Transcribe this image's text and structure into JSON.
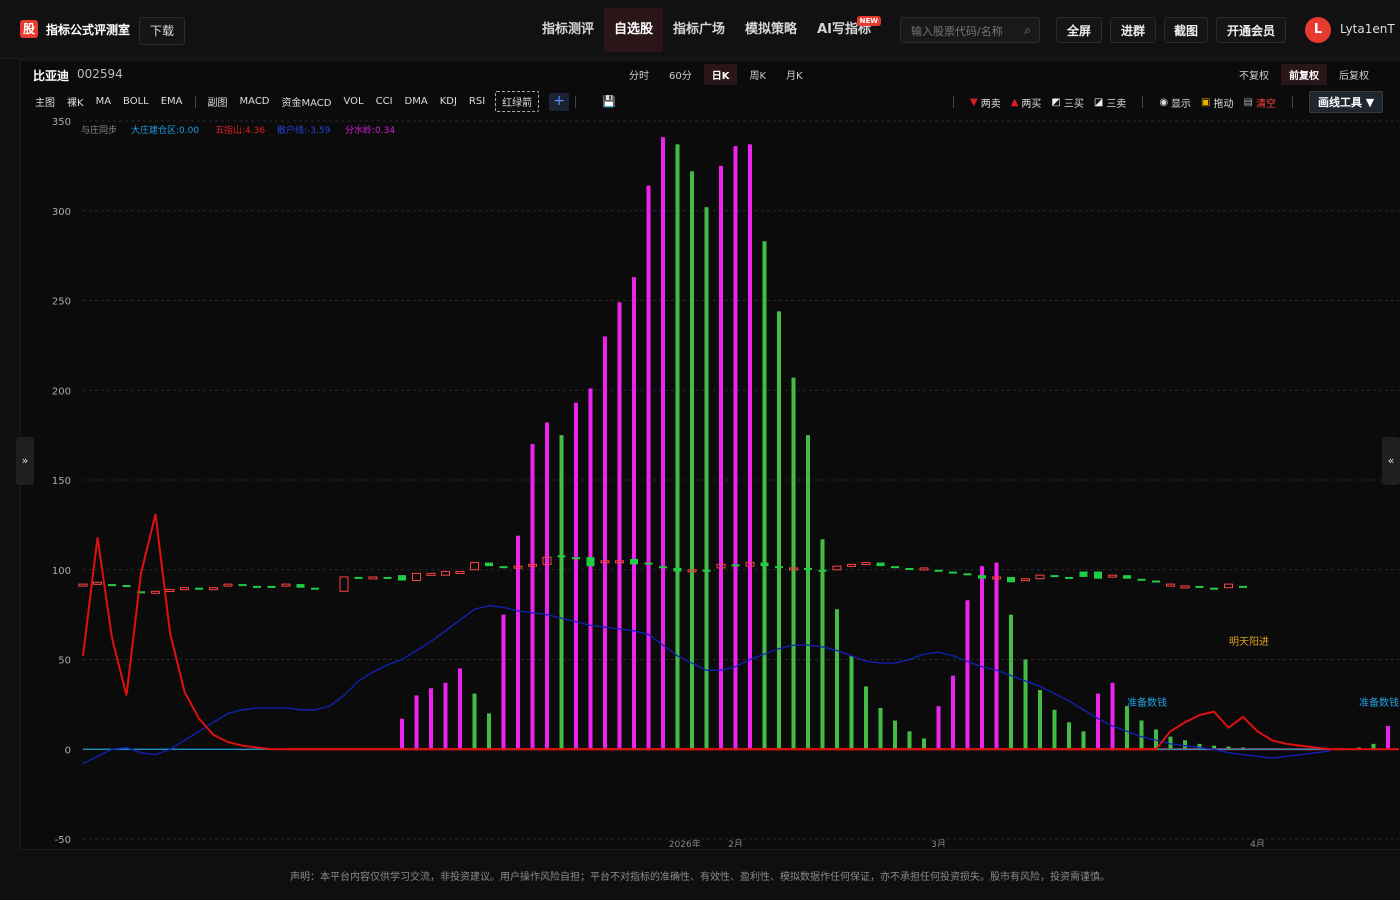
{
  "app": {
    "logo_glyph": "股",
    "title": "指标公式评测室",
    "download_label": "下载"
  },
  "nav": [
    {
      "label": "指标测评",
      "active": false
    },
    {
      "label": "自选股",
      "active": true
    },
    {
      "label": "指标广场",
      "active": false
    },
    {
      "label": "模拟策略",
      "active": false
    },
    {
      "label": "AI写指标",
      "active": false,
      "badge": "NEW"
    }
  ],
  "search": {
    "placeholder": "输入股票代码/名称",
    "icon": "search-icon"
  },
  "top_buttons": {
    "fullscreen": "全屏",
    "join_group": "进群",
    "screenshot": "截图",
    "vip": "开通会员"
  },
  "user": {
    "initial": "L",
    "name": "Lyta1enT",
    "avatar_color": "#e63b2e"
  },
  "stock": {
    "name": "比亚迪",
    "code": "002594"
  },
  "period_tabs": [
    {
      "label": "分时"
    },
    {
      "label": "60分"
    },
    {
      "label": "日K",
      "active": true
    },
    {
      "label": "周K"
    },
    {
      "label": "月K"
    }
  ],
  "adjust_tabs": [
    {
      "label": "不复权"
    },
    {
      "label": "前复权",
      "active": true
    },
    {
      "label": "后复权"
    }
  ],
  "indicators": {
    "main_label": "主图",
    "main": [
      "裸K",
      "MA",
      "BOLL",
      "EMA"
    ],
    "sub_label": "副图",
    "sub": [
      "MACD",
      "资金MACD",
      "VOL",
      "CCI",
      "DMA",
      "KDJ",
      "RSI"
    ],
    "custom": "红绿箭"
  },
  "tools": {
    "two_sell": "两卖",
    "two_buy": "两买",
    "three_buy": "三买",
    "three_sell": "三卖",
    "show": "显示",
    "drag": "拖动",
    "clear": "清空",
    "draw_tools": "画线工具 ▼"
  },
  "legend": [
    {
      "label": "与庄同步",
      "color": "#888888"
    },
    {
      "label": "大庄建仓区:0.00",
      "color": "#1e9ee8"
    },
    {
      "label": "五指山:4.36",
      "color": "#e02020"
    },
    {
      "label": "散户线:-3.59",
      "color": "#2244dd"
    },
    {
      "label": "分水岭:0.34",
      "color": "#d020d0"
    }
  ],
  "annotations": {
    "tomorrow": "明天阳进",
    "prepare1": "准备数钱",
    "prepare2": "准备数钱"
  },
  "x_labels": [
    "2026年",
    "2月",
    "3月",
    "4月"
  ],
  "colors": {
    "up_bar": "#ee22ee",
    "down_bar": "#44bb44",
    "candle_up": "#ff4444",
    "candle_down": "#22cc44",
    "red_line": "#e01010",
    "blue_line": "#1122bb",
    "zero_line": "#1aa0d0"
  },
  "disclaimer": "声明：本平台内容仅供学习交流，非投资建议。用户操作风险自担；平台不对指标的准确性、有效性、盈利性、模拟数据作任何保证，亦不承担任何投资损失。股市有风险，投资需谨慎。",
  "chart_data": {
    "type": "bar",
    "ylim": [
      -50,
      350
    ],
    "yticks": [
      350,
      300,
      250,
      200,
      150,
      100,
      50,
      0,
      -50
    ],
    "grid": true,
    "bars": [
      {
        "x": 22,
        "v": 17,
        "c": "up"
      },
      {
        "x": 23,
        "v": 30,
        "c": "up"
      },
      {
        "x": 24,
        "v": 34,
        "c": "up"
      },
      {
        "x": 25,
        "v": 37,
        "c": "up"
      },
      {
        "x": 26,
        "v": 45,
        "c": "up"
      },
      {
        "x": 27,
        "v": 31,
        "c": "down"
      },
      {
        "x": 28,
        "v": 20,
        "c": "down"
      },
      {
        "x": 29,
        "v": 75,
        "c": "up"
      },
      {
        "x": 30,
        "v": 119,
        "c": "up"
      },
      {
        "x": 31,
        "v": 170,
        "c": "up"
      },
      {
        "x": 32,
        "v": 182,
        "c": "up"
      },
      {
        "x": 33,
        "v": 175,
        "c": "down"
      },
      {
        "x": 34,
        "v": 193,
        "c": "up"
      },
      {
        "x": 35,
        "v": 201,
        "c": "up"
      },
      {
        "x": 36,
        "v": 230,
        "c": "up"
      },
      {
        "x": 37,
        "v": 249,
        "c": "up"
      },
      {
        "x": 38,
        "v": 263,
        "c": "up"
      },
      {
        "x": 39,
        "v": 314,
        "c": "up"
      },
      {
        "x": 40,
        "v": 341,
        "c": "up"
      },
      {
        "x": 41,
        "v": 337,
        "c": "down"
      },
      {
        "x": 42,
        "v": 322,
        "c": "down"
      },
      {
        "x": 43,
        "v": 302,
        "c": "down"
      },
      {
        "x": 44,
        "v": 325,
        "c": "up"
      },
      {
        "x": 45,
        "v": 336,
        "c": "up"
      },
      {
        "x": 46,
        "v": 337,
        "c": "up"
      },
      {
        "x": 47,
        "v": 283,
        "c": "down"
      },
      {
        "x": 48,
        "v": 244,
        "c": "down"
      },
      {
        "x": 49,
        "v": 207,
        "c": "down"
      },
      {
        "x": 50,
        "v": 175,
        "c": "down"
      },
      {
        "x": 51,
        "v": 117,
        "c": "down"
      },
      {
        "x": 52,
        "v": 78,
        "c": "down"
      },
      {
        "x": 53,
        "v": 52,
        "c": "down"
      },
      {
        "x": 54,
        "v": 35,
        "c": "down"
      },
      {
        "x": 55,
        "v": 23,
        "c": "down"
      },
      {
        "x": 56,
        "v": 16,
        "c": "down"
      },
      {
        "x": 57,
        "v": 10,
        "c": "down"
      },
      {
        "x": 58,
        "v": 6,
        "c": "down"
      },
      {
        "x": 59,
        "v": 24,
        "c": "up"
      },
      {
        "x": 60,
        "v": 41,
        "c": "up"
      },
      {
        "x": 61,
        "v": 83,
        "c": "up"
      },
      {
        "x": 62,
        "v": 102,
        "c": "up"
      },
      {
        "x": 63,
        "v": 104,
        "c": "up"
      },
      {
        "x": 64,
        "v": 75,
        "c": "down"
      },
      {
        "x": 65,
        "v": 50,
        "c": "down"
      },
      {
        "x": 66,
        "v": 33,
        "c": "down"
      },
      {
        "x": 67,
        "v": 22,
        "c": "down"
      },
      {
        "x": 68,
        "v": 15,
        "c": "down"
      },
      {
        "x": 69,
        "v": 10,
        "c": "down"
      },
      {
        "x": 70,
        "v": 31,
        "c": "up"
      },
      {
        "x": 71,
        "v": 37,
        "c": "up"
      },
      {
        "x": 72,
        "v": 24,
        "c": "down"
      },
      {
        "x": 73,
        "v": 16,
        "c": "down"
      },
      {
        "x": 74,
        "v": 11,
        "c": "down"
      },
      {
        "x": 75,
        "v": 7,
        "c": "down"
      },
      {
        "x": 76,
        "v": 5,
        "c": "down"
      },
      {
        "x": 77,
        "v": 3,
        "c": "down"
      },
      {
        "x": 78,
        "v": 2,
        "c": "down"
      },
      {
        "x": 79,
        "v": 1.5,
        "c": "down"
      },
      {
        "x": 80,
        "v": 1,
        "c": "down"
      },
      {
        "x": 88,
        "v": 1,
        "c": "down"
      },
      {
        "x": 89,
        "v": 3,
        "c": "down"
      },
      {
        "x": 90,
        "v": 13,
        "c": "up"
      },
      {
        "x": 91,
        "v": 9,
        "c": "down"
      },
      {
        "x": 92,
        "v": 6,
        "c": "down"
      },
      {
        "x": 93,
        "v": 4,
        "c": "down"
      },
      {
        "x": 94,
        "v": 2,
        "c": "down"
      },
      {
        "x": 95,
        "v": 1.5,
        "c": "down"
      },
      {
        "x": 96,
        "v": 1,
        "c": "down"
      },
      {
        "x": 97,
        "v": 1,
        "c": "down"
      }
    ],
    "candles": [
      {
        "x": 0,
        "o": 92,
        "c": 92,
        "u": 1
      },
      {
        "x": 1,
        "o": 92,
        "c": 93,
        "u": 1
      },
      {
        "x": 2,
        "o": 92,
        "c": 91.5,
        "u": 0
      },
      {
        "x": 3,
        "o": 91.5,
        "c": 91,
        "u": 0
      },
      {
        "x": 4,
        "o": 88,
        "c": 87,
        "u": 0
      },
      {
        "x": 5,
        "o": 87,
        "c": 88,
        "u": 1
      },
      {
        "x": 6,
        "o": 88,
        "c": 89,
        "u": 1
      },
      {
        "x": 7,
        "o": 90,
        "c": 90,
        "u": 1
      },
      {
        "x": 8,
        "o": 90,
        "c": 89,
        "u": 0
      },
      {
        "x": 9,
        "o": 90,
        "c": 90,
        "u": 1
      },
      {
        "x": 10,
        "o": 91,
        "c": 92,
        "u": 1
      },
      {
        "x": 11,
        "o": 92,
        "c": 91,
        "u": 0
      },
      {
        "x": 12,
        "o": 91,
        "c": 90,
        "u": 0
      },
      {
        "x": 13,
        "o": 91,
        "c": 90,
        "u": 0
      },
      {
        "x": 14,
        "o": 91,
        "c": 92,
        "u": 1
      },
      {
        "x": 15,
        "o": 92,
        "c": 90,
        "u": 0
      },
      {
        "x": 16,
        "o": 90,
        "c": 89,
        "u": 0
      },
      {
        "x": 18,
        "o": 88,
        "c": 96,
        "u": 1
      },
      {
        "x": 19,
        "o": 96,
        "c": 95,
        "u": 0
      },
      {
        "x": 20,
        "o": 95,
        "c": 96,
        "u": 1
      },
      {
        "x": 21,
        "o": 96,
        "c": 95,
        "u": 0
      },
      {
        "x": 22,
        "o": 97,
        "c": 94,
        "u": 0
      },
      {
        "x": 23,
        "o": 94,
        "c": 98,
        "u": 1
      },
      {
        "x": 24,
        "o": 98,
        "c": 98,
        "u": 1
      },
      {
        "x": 25,
        "o": 97,
        "c": 99,
        "u": 1
      },
      {
        "x": 26,
        "o": 99,
        "c": 99,
        "u": 1
      },
      {
        "x": 27,
        "o": 100,
        "c": 104,
        "u": 1
      },
      {
        "x": 28,
        "o": 104,
        "c": 102,
        "u": 0
      },
      {
        "x": 29,
        "o": 102,
        "c": 101,
        "u": 0
      },
      {
        "x": 30,
        "o": 101,
        "c": 102,
        "u": 1
      },
      {
        "x": 31,
        "o": 102,
        "c": 103,
        "u": 1
      },
      {
        "x": 32,
        "o": 103,
        "c": 107,
        "u": 1
      },
      {
        "x": 33,
        "o": 107,
        "c": 108,
        "u": 0
      },
      {
        "x": 34,
        "o": 107,
        "c": 107,
        "u": 0
      },
      {
        "x": 35,
        "o": 107,
        "c": 102,
        "u": 0
      },
      {
        "x": 36,
        "o": 104,
        "c": 105,
        "u": 1
      },
      {
        "x": 37,
        "o": 105,
        "c": 104,
        "u": 1
      },
      {
        "x": 38,
        "o": 106,
        "c": 103,
        "u": 0
      },
      {
        "x": 39,
        "o": 104,
        "c": 103,
        "u": 0
      },
      {
        "x": 40,
        "o": 102,
        "c": 101,
        "u": 0
      },
      {
        "x": 41,
        "o": 101,
        "c": 99,
        "u": 0
      },
      {
        "x": 42,
        "o": 99,
        "c": 100,
        "u": 1
      },
      {
        "x": 43,
        "o": 100,
        "c": 99,
        "u": 0
      },
      {
        "x": 44,
        "o": 101,
        "c": 103,
        "u": 1
      },
      {
        "x": 45,
        "o": 103,
        "c": 102,
        "u": 0
      },
      {
        "x": 46,
        "o": 102,
        "c": 104,
        "u": 1
      },
      {
        "x": 47,
        "o": 104,
        "c": 102,
        "u": 0
      },
      {
        "x": 48,
        "o": 102,
        "c": 101,
        "u": 0
      },
      {
        "x": 49,
        "o": 101,
        "c": 101,
        "u": 1
      },
      {
        "x": 50,
        "o": 101,
        "c": 100,
        "u": 0
      },
      {
        "x": 51,
        "o": 100,
        "c": 99,
        "u": 0
      },
      {
        "x": 52,
        "o": 100,
        "c": 102,
        "u": 1
      },
      {
        "x": 53,
        "o": 102,
        "c": 103,
        "u": 1
      },
      {
        "x": 54,
        "o": 103,
        "c": 104,
        "u": 1
      },
      {
        "x": 55,
        "o": 104,
        "c": 102,
        "u": 0
      },
      {
        "x": 56,
        "o": 102,
        "c": 101,
        "u": 0
      },
      {
        "x": 57,
        "o": 101,
        "c": 100,
        "u": 0
      },
      {
        "x": 58,
        "o": 101,
        "c": 100,
        "u": 1
      },
      {
        "x": 59,
        "o": 100,
        "c": 99,
        "u": 0
      },
      {
        "x": 60,
        "o": 99,
        "c": 99,
        "u": 0
      },
      {
        "x": 61,
        "o": 98,
        "c": 97,
        "u": 0
      },
      {
        "x": 62,
        "o": 97,
        "c": 95,
        "u": 0
      },
      {
        "x": 63,
        "o": 95,
        "c": 96,
        "u": 1
      },
      {
        "x": 64,
        "o": 96,
        "c": 93,
        "u": 0
      },
      {
        "x": 65,
        "o": 94,
        "c": 95,
        "u": 1
      },
      {
        "x": 66,
        "o": 95,
        "c": 97,
        "u": 1
      },
      {
        "x": 67,
        "o": 97,
        "c": 96,
        "u": 0
      },
      {
        "x": 68,
        "o": 96,
        "c": 95,
        "u": 0
      },
      {
        "x": 69,
        "o": 96,
        "c": 99,
        "u": 0
      },
      {
        "x": 70,
        "o": 99,
        "c": 95,
        "u": 0
      },
      {
        "x": 71,
        "o": 96,
        "c": 97,
        "u": 1
      },
      {
        "x": 72,
        "o": 97,
        "c": 95,
        "u": 0
      },
      {
        "x": 73,
        "o": 95,
        "c": 94,
        "u": 0
      },
      {
        "x": 74,
        "o": 94,
        "c": 93,
        "u": 0
      },
      {
        "x": 75,
        "o": 92,
        "c": 91,
        "u": 1
      },
      {
        "x": 76,
        "o": 91,
        "c": 91,
        "u": 1
      },
      {
        "x": 77,
        "o": 91,
        "c": 90,
        "u": 0
      },
      {
        "x": 78,
        "o": 90,
        "c": 89,
        "u": 0
      },
      {
        "x": 79,
        "o": 90,
        "c": 92,
        "u": 1
      },
      {
        "x": 80,
        "o": 91,
        "c": 91,
        "u": 0
      }
    ],
    "red_line": [
      [
        0,
        52
      ],
      [
        1,
        118
      ],
      [
        2,
        62
      ],
      [
        3,
        30
      ],
      [
        4,
        98
      ],
      [
        5,
        131
      ],
      [
        6,
        65
      ],
      [
        7,
        32
      ],
      [
        8,
        17
      ],
      [
        9,
        8
      ],
      [
        10,
        4
      ],
      [
        11,
        2
      ],
      [
        12,
        1
      ],
      [
        13,
        0
      ],
      [
        14,
        0
      ],
      [
        70,
        0
      ],
      [
        71,
        0
      ],
      [
        72,
        0
      ],
      [
        73,
        0
      ],
      [
        74,
        0
      ],
      [
        75,
        10
      ],
      [
        76,
        15
      ],
      [
        77,
        19
      ],
      [
        78,
        21
      ],
      [
        79,
        12
      ],
      [
        80,
        18
      ],
      [
        81,
        10
      ],
      [
        82,
        5
      ],
      [
        83,
        3
      ],
      [
        84,
        2
      ],
      [
        85,
        1
      ],
      [
        86,
        0
      ],
      [
        87,
        0
      ],
      [
        88,
        0
      ],
      [
        89,
        0
      ],
      [
        90,
        0
      ],
      [
        91,
        0
      ],
      [
        92,
        12
      ],
      [
        93,
        18
      ],
      [
        94,
        20
      ],
      [
        95,
        12
      ],
      [
        96,
        17
      ],
      [
        97,
        10
      ],
      [
        98,
        6
      ],
      [
        99,
        5
      ]
    ],
    "blue_line": [
      [
        0,
        -8
      ],
      [
        1,
        -4
      ],
      [
        2,
        0
      ],
      [
        3,
        1
      ],
      [
        4,
        -2
      ],
      [
        5,
        -3
      ],
      [
        6,
        0
      ],
      [
        7,
        5
      ],
      [
        8,
        10
      ],
      [
        9,
        15
      ],
      [
        10,
        20
      ],
      [
        11,
        22
      ],
      [
        12,
        23
      ],
      [
        13,
        23
      ],
      [
        14,
        23
      ],
      [
        15,
        22
      ],
      [
        16,
        22
      ],
      [
        17,
        24
      ],
      [
        18,
        30
      ],
      [
        19,
        38
      ],
      [
        20,
        43
      ],
      [
        21,
        47
      ],
      [
        22,
        50
      ],
      [
        23,
        55
      ],
      [
        24,
        60
      ],
      [
        25,
        66
      ],
      [
        26,
        72
      ],
      [
        27,
        78
      ],
      [
        28,
        80
      ],
      [
        29,
        79
      ],
      [
        30,
        77
      ],
      [
        31,
        76
      ],
      [
        32,
        75
      ],
      [
        33,
        73
      ],
      [
        34,
        71
      ],
      [
        35,
        69
      ],
      [
        36,
        68
      ],
      [
        37,
        67
      ],
      [
        38,
        66
      ],
      [
        39,
        64
      ],
      [
        40,
        58
      ],
      [
        41,
        52
      ],
      [
        42,
        48
      ],
      [
        43,
        44
      ],
      [
        44,
        44
      ],
      [
        45,
        46
      ],
      [
        46,
        50
      ],
      [
        47,
        53
      ],
      [
        48,
        56
      ],
      [
        49,
        58
      ],
      [
        50,
        58
      ],
      [
        51,
        57
      ],
      [
        52,
        55
      ],
      [
        53,
        52
      ],
      [
        54,
        49
      ],
      [
        55,
        48
      ],
      [
        56,
        48
      ],
      [
        57,
        50
      ],
      [
        58,
        53
      ],
      [
        59,
        54
      ],
      [
        60,
        52
      ],
      [
        61,
        49
      ],
      [
        62,
        46
      ],
      [
        63,
        44
      ],
      [
        64,
        41
      ],
      [
        65,
        38
      ],
      [
        66,
        35
      ],
      [
        67,
        31
      ],
      [
        68,
        27
      ],
      [
        69,
        22
      ],
      [
        70,
        17
      ],
      [
        71,
        13
      ],
      [
        72,
        10
      ],
      [
        73,
        7
      ],
      [
        74,
        5
      ],
      [
        75,
        3
      ],
      [
        76,
        2
      ],
      [
        77,
        1
      ],
      [
        78,
        0
      ],
      [
        79,
        -2
      ],
      [
        80,
        -3
      ],
      [
        81,
        -4
      ],
      [
        82,
        -5
      ],
      [
        83,
        -4
      ],
      [
        84,
        -3
      ],
      [
        85,
        -2
      ],
      [
        86,
        -1
      ]
    ]
  }
}
